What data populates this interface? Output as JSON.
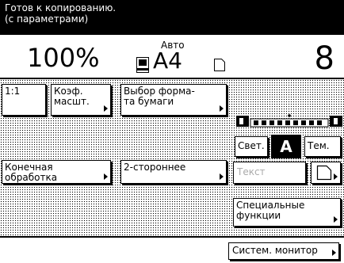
{
  "status": {
    "line1": "Готов к копированию.",
    "line2": "(с параметрами)"
  },
  "info": {
    "zoom": "100%",
    "paper_mode": "Авто",
    "paper_size": "A4",
    "copies": "8"
  },
  "buttons": {
    "ratio_1to1": "1:1",
    "zoom_ratio": "Коэф.\nмасшт.",
    "paper_select": "Выбор форма-\nта бумаги",
    "finishing": "Конечная\nобработка",
    "two_sided": "2-стороннее",
    "special": "Специальные\nфункции",
    "system_monitor": "Систем. монитор"
  },
  "density": {
    "light": "Свет.",
    "auto": "A",
    "dark": "Тем.",
    "left_mark": "◧",
    "right_mark": "◨"
  },
  "image_mode": {
    "text": "Текст"
  }
}
